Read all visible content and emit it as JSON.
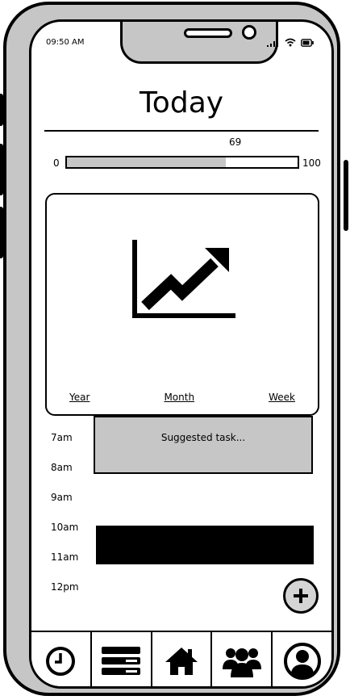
{
  "status_bar": {
    "time": "09:50 AM"
  },
  "header": {
    "title": "Today"
  },
  "progress": {
    "value": 69,
    "value_label": "69",
    "min_label": "0",
    "max_label": "100"
  },
  "popover": {
    "chart_icon": "trending-up-chart-icon",
    "links": [
      {
        "label": "Year"
      },
      {
        "label": "Month"
      },
      {
        "label": "Week"
      }
    ]
  },
  "schedule": {
    "hours": [
      "7am",
      "8am",
      "9am",
      "10am",
      "11am",
      "12pm"
    ],
    "suggested_label": "Suggested task..."
  },
  "fab": {
    "icon": "plus-icon"
  },
  "nav": {
    "items": [
      {
        "icon": "clock-icon"
      },
      {
        "icon": "list-icon"
      },
      {
        "icon": "home-icon"
      },
      {
        "icon": "group-icon"
      },
      {
        "icon": "profile-icon"
      }
    ]
  },
  "colors": {
    "fill": "#c6c6c6",
    "ink": "#000000",
    "fab": "#d4d4d4"
  }
}
